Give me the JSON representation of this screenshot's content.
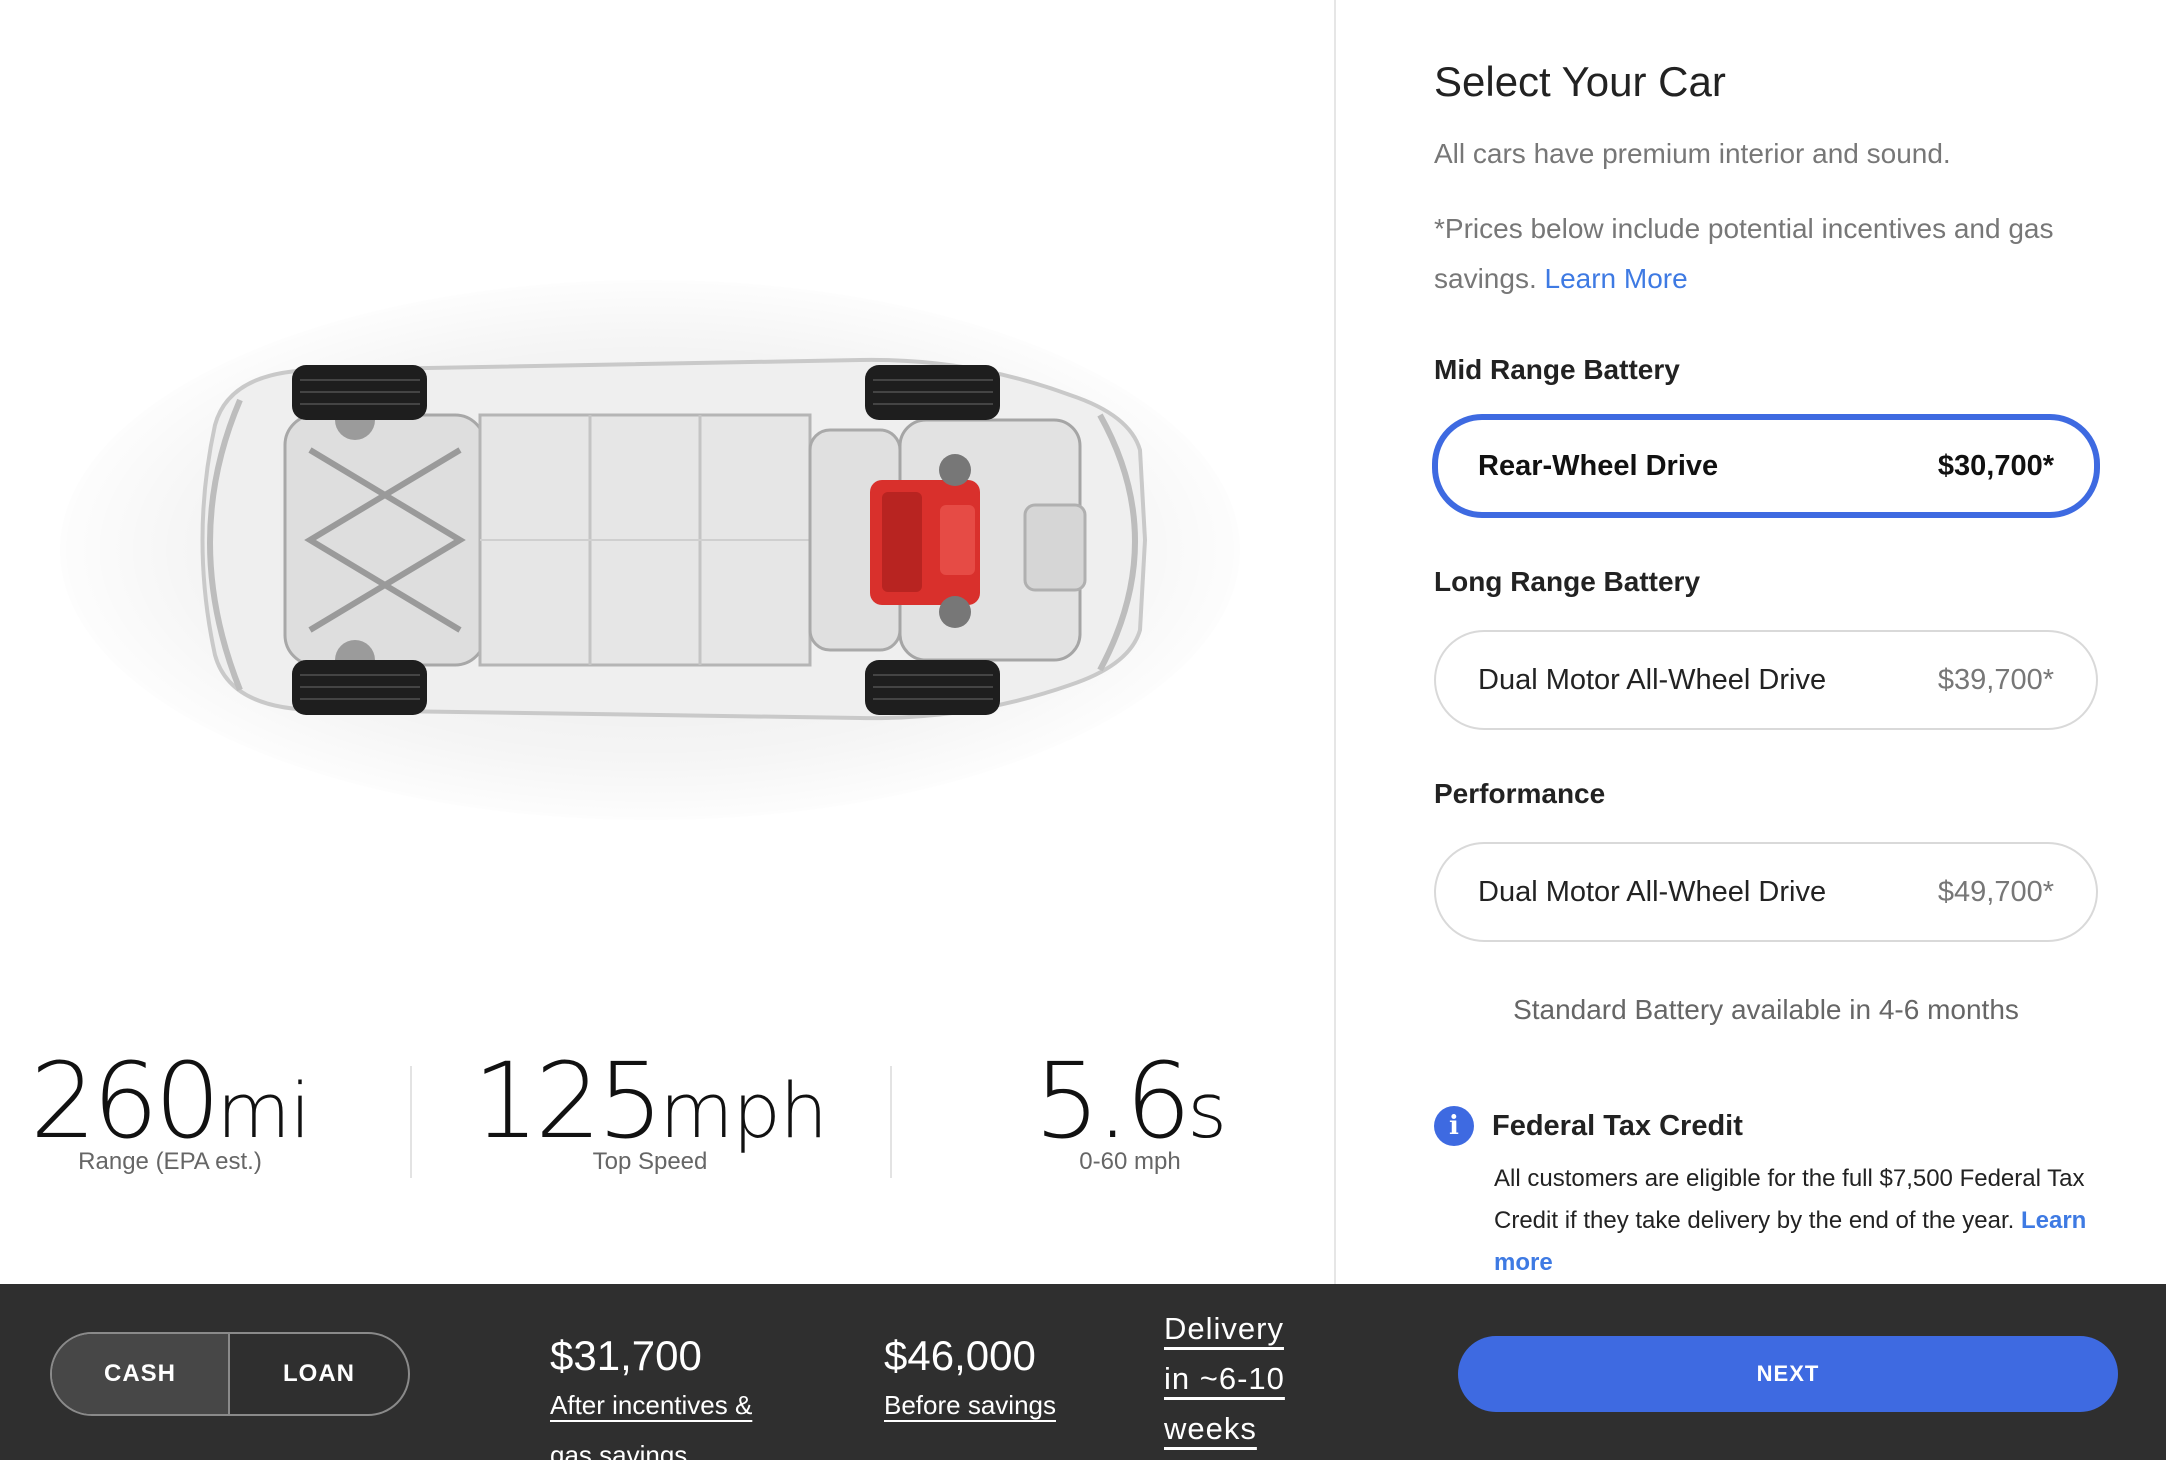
{
  "stats": [
    {
      "value": "260",
      "unit": "mi",
      "label": "Range (EPA est.)"
    },
    {
      "value": "125",
      "unit": "mph",
      "label": "Top Speed"
    },
    {
      "value": "5.6",
      "unit": "s",
      "label": "0-60 mph"
    }
  ],
  "configurator": {
    "title": "Select Your Car",
    "subtitle": "All cars have premium interior and sound.",
    "note_prefix": "*Prices below include potential incentives and gas savings.",
    "note_link": "Learn More",
    "sections": [
      {
        "title": "Mid Range Battery",
        "option": {
          "name": "Rear-Wheel Drive",
          "price": "$30,700*",
          "selected": true
        }
      },
      {
        "title": "Long Range Battery",
        "option": {
          "name": "Dual Motor All-Wheel Drive",
          "price": "$39,700*",
          "selected": false
        }
      },
      {
        "title": "Performance",
        "option": {
          "name": "Dual Motor All-Wheel Drive",
          "price": "$49,700*",
          "selected": false
        }
      }
    ],
    "availability": "Standard Battery available in 4-6 months",
    "tax_credit": {
      "icon_text": "i",
      "title": "Federal Tax Credit",
      "body": "All customers are eligible for the full $7,500 Federal Tax Credit if they take delivery by the end of the year.",
      "link": "Learn more"
    }
  },
  "bottom_bar": {
    "payment_tabs": [
      {
        "label": "CASH",
        "active": true
      },
      {
        "label": "LOAN",
        "active": false
      }
    ],
    "price_after": {
      "amount": "$31,700",
      "caption": "After incentives & gas savings"
    },
    "price_before": {
      "amount": "$46,000",
      "caption": "Before savings"
    },
    "delivery": "Delivery in ~6-10 weeks",
    "next_label": "NEXT"
  },
  "colors": {
    "accent": "#3e6ae1",
    "link": "#3e7ae3",
    "bar_background": "#2f2f2f",
    "motor_red": "#d9302c"
  },
  "icons": {
    "info": "info-icon"
  }
}
